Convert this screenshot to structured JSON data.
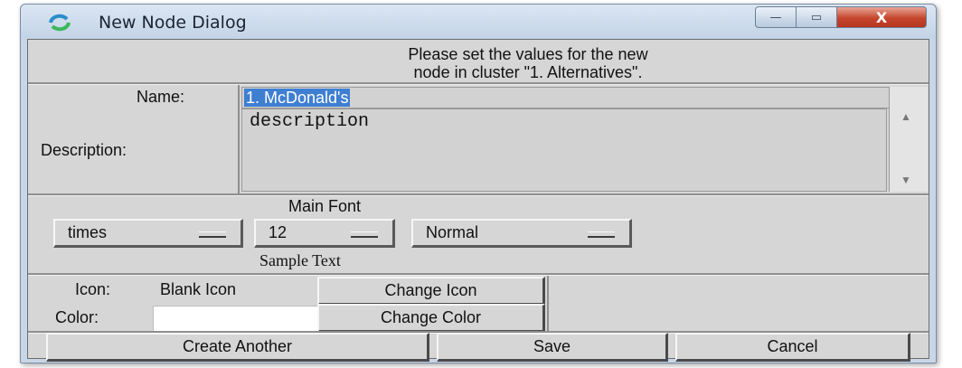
{
  "window": {
    "title": "New Node Dialog",
    "controls": {
      "minimize": "—",
      "maximize": "▭",
      "close": "X"
    }
  },
  "instructions": {
    "line1": "Please set the values for the new",
    "line2": "node in cluster \"1. Alternatives\"."
  },
  "name_field": {
    "label": "Name:",
    "value": "1. McDonald's"
  },
  "description_field": {
    "label": "Description:",
    "value": "description"
  },
  "font": {
    "heading": "Main Font",
    "family": "times",
    "size": "12",
    "style": "Normal",
    "sample": "Sample Text"
  },
  "icon": {
    "label": "Icon:",
    "value": "Blank Icon",
    "change_button": "Change Icon"
  },
  "color": {
    "label": "Color:",
    "swatch": "#ffffff",
    "change_button": "Change Color"
  },
  "actions": {
    "create_another": "Create Another",
    "save": "Save",
    "cancel": "Cancel"
  },
  "colors": {
    "selection": "#3f7fd2",
    "title_bar": "#c9d6e6",
    "close_button": "#c6452d"
  }
}
